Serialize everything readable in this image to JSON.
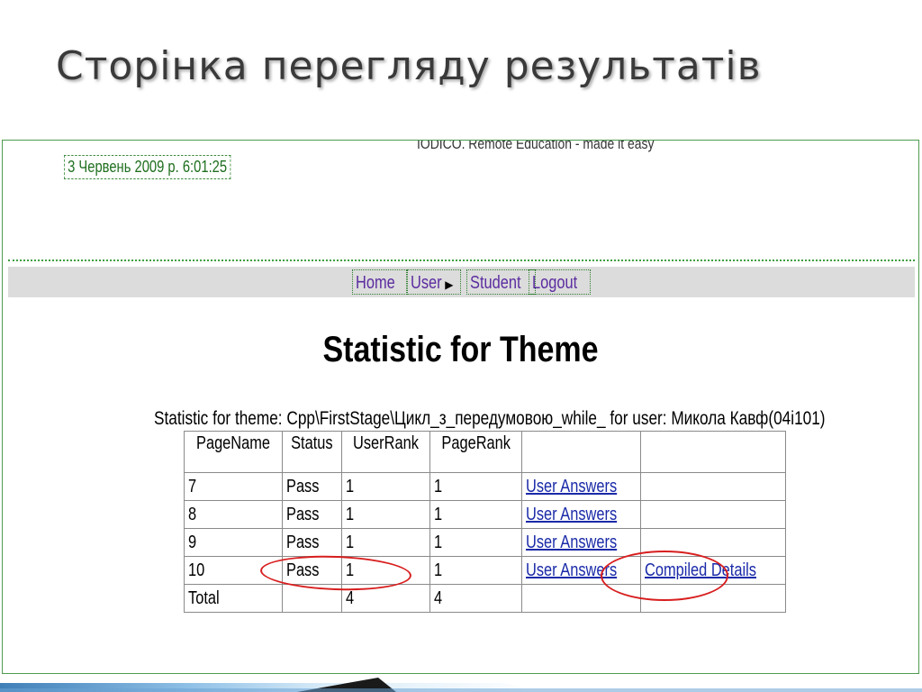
{
  "slide": {
    "title": "Сторінка перегляду результатів"
  },
  "app": {
    "banner": "IODICO. Remote Education - made it easy",
    "timestamp": "3 Червень 2009 р. 6:01:25"
  },
  "nav": {
    "home": "Home",
    "user": "User",
    "student": "Student",
    "logout": "Logout"
  },
  "page": {
    "heading": "Statistic for Theme",
    "caption": "Statistic for theme: Cpp\\FirstStage\\Цикл_з_передумовою_while_ for user: Микола Кавф(04і101)"
  },
  "table": {
    "headers": [
      "PageName",
      "Status",
      "UserRank",
      "PageRank",
      "",
      ""
    ],
    "rows": [
      {
        "page": "7",
        "status": "Pass",
        "user_rank": "1",
        "page_rank": "1",
        "answers": "User Answers",
        "details": ""
      },
      {
        "page": "8",
        "status": "Pass",
        "user_rank": "1",
        "page_rank": "1",
        "answers": "User Answers",
        "details": ""
      },
      {
        "page": "9",
        "status": "Pass",
        "user_rank": "1",
        "page_rank": "1",
        "answers": "User Answers",
        "details": ""
      },
      {
        "page": "10",
        "status": "Pass",
        "user_rank": "1",
        "page_rank": "1",
        "answers": "User Answers",
        "details": "Compiled Details"
      }
    ],
    "total": {
      "page": "Total",
      "status": "",
      "user_rank": "4",
      "page_rank": "4",
      "answers": "",
      "details": ""
    }
  },
  "colors": {
    "highlight_oval": "#d81e1e",
    "link": "#1a2aa8",
    "nav_link": "#5b2ca0",
    "border_green": "#4f9b4f"
  }
}
